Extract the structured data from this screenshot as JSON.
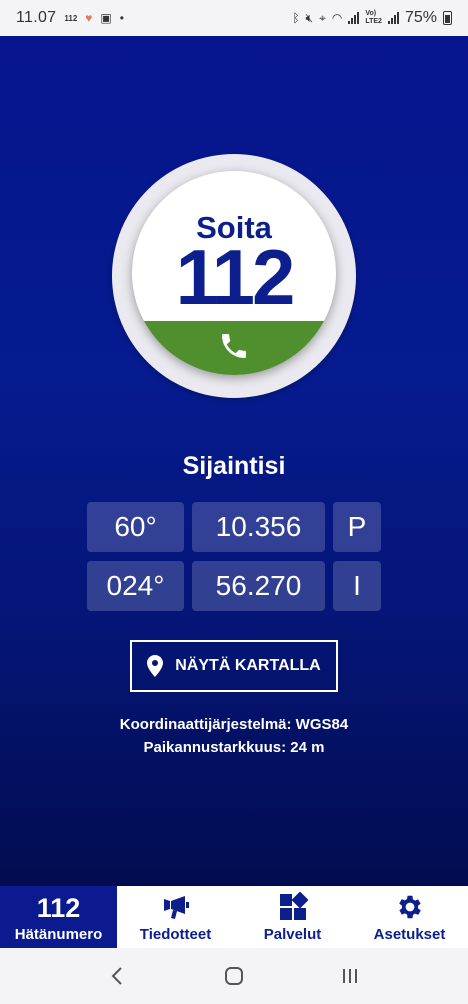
{
  "status_bar": {
    "time": "11.07",
    "small_label": "112",
    "network_label": "LTE2",
    "volte_label": "Vo)",
    "battery": "75%"
  },
  "call_button": {
    "label": "Soita",
    "number": "112"
  },
  "location": {
    "title": "Sijaintisi",
    "lat": {
      "degrees": "60°",
      "minutes": "10.356",
      "hemisphere": "P"
    },
    "lon": {
      "degrees": "024°",
      "minutes": "56.270",
      "hemisphere": "I"
    }
  },
  "map_button": {
    "label": "NÄYTÄ KARTALLA"
  },
  "info": {
    "coordinate_system": "Koordinaattijärjestelmä: WGS84",
    "accuracy": "Paikannustarkkuus: 24 m"
  },
  "bottom_nav": {
    "emergency": {
      "big": "112",
      "label": "Hätänumero"
    },
    "announcements": {
      "label": "Tiedotteet"
    },
    "services": {
      "label": "Palvelut"
    },
    "settings": {
      "label": "Asetukset"
    }
  },
  "colors": {
    "primary_blue": "#0b1a8e",
    "green": "#4f8f2d",
    "white": "#ffffff"
  }
}
